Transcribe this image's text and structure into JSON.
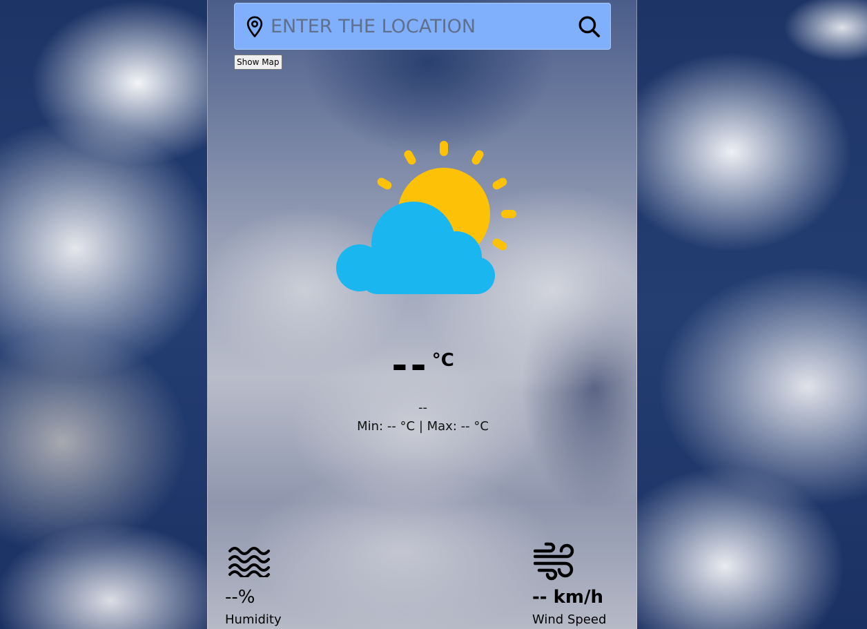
{
  "search": {
    "placeholder": "ENTER THE LOCATION",
    "value": ""
  },
  "map_button": {
    "label": "Show Map"
  },
  "weather": {
    "icon": "partly-cloudy-icon",
    "temperature": "--",
    "unit": "°C",
    "condition": "--",
    "minmax": "Min: -- °C | Max: -- °C"
  },
  "humidity": {
    "icon": "waves-icon",
    "value": "--%",
    "label": "Humidity"
  },
  "wind": {
    "icon": "wind-icon",
    "value": "-- km/h",
    "label": "Wind Speed"
  },
  "colors": {
    "search_bg": "#80b0fb",
    "sun": "#fdc208",
    "cloud": "#1ab6ef"
  }
}
